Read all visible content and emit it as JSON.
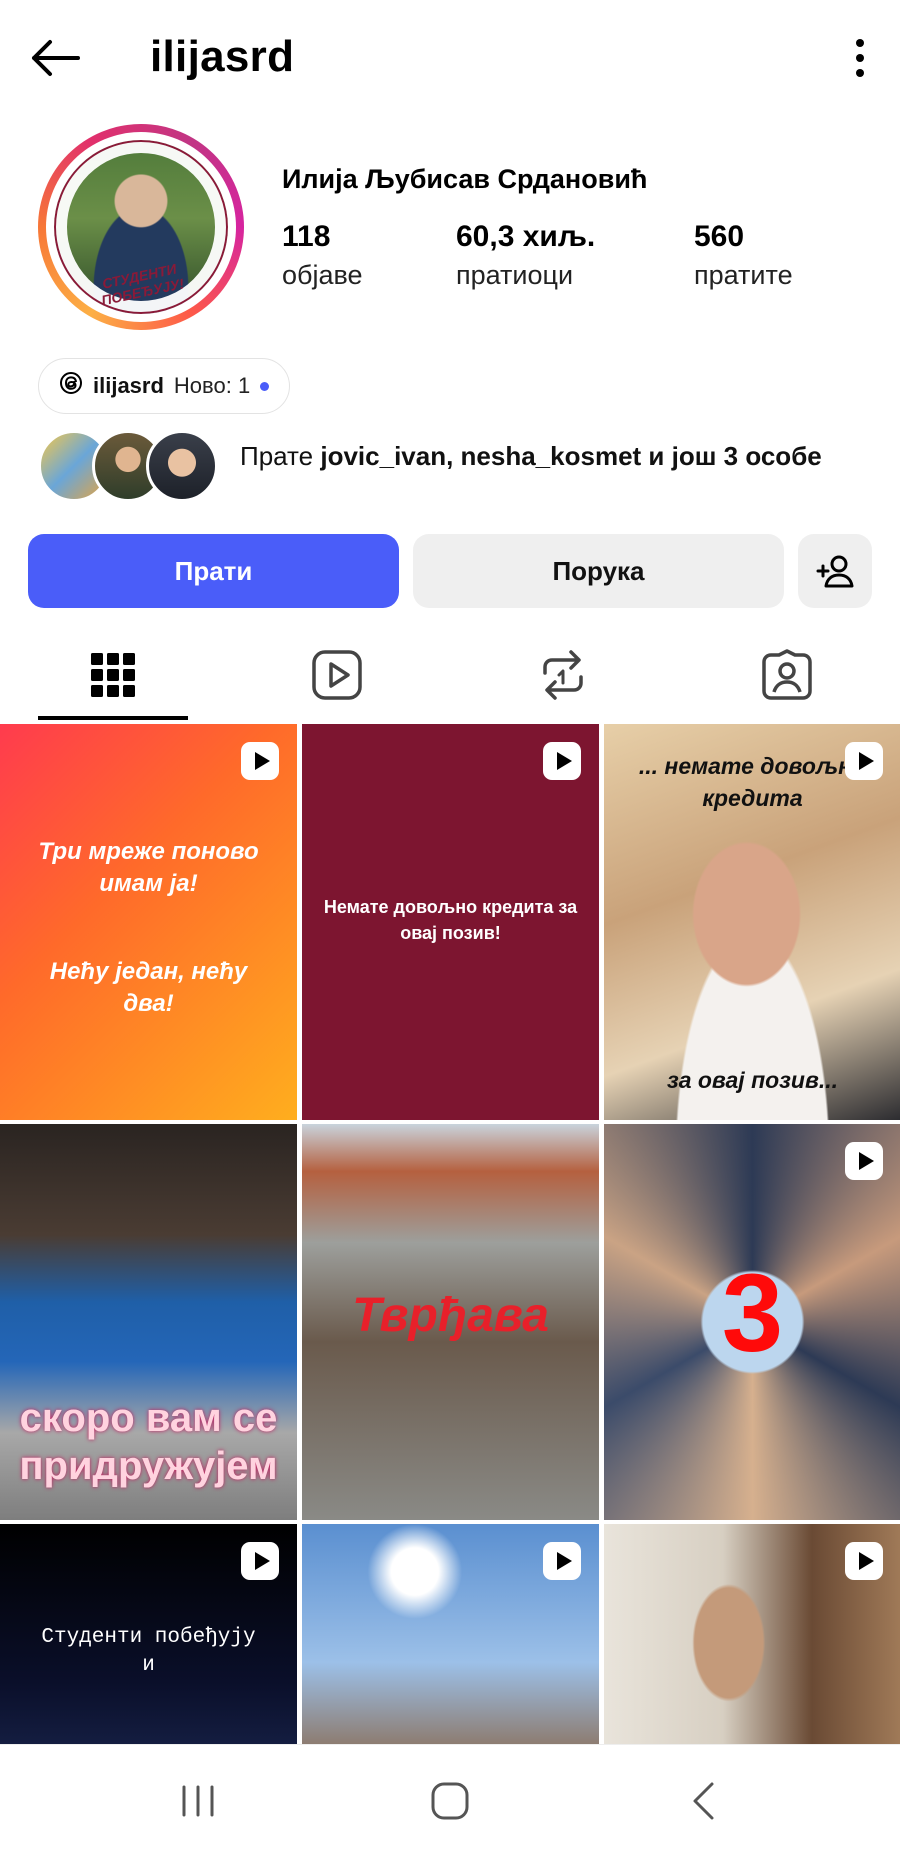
{
  "header": {
    "username": "ilijasrd"
  },
  "profile": {
    "full_name": "Илија Љубисав Срдановић",
    "avatar_caption": "СТУДЕНТИ ПОБЕЂУЈУ!",
    "stats": [
      {
        "value": "118",
        "label": "објаве"
      },
      {
        "value": "60,3 хиљ.",
        "label": "пратиоци"
      },
      {
        "value": "560",
        "label": "пратите"
      }
    ],
    "threads": {
      "handle": "ilijasrd",
      "new_label": "Ново: 1"
    },
    "mutual": {
      "prefix": "Прате",
      "names": "jovic_ivan, nesha_kosmet",
      "suffix": "и још 3 особе"
    }
  },
  "actions": {
    "follow": "Прати",
    "message": "Порука"
  },
  "tabs": [
    {
      "icon": "grid-icon",
      "active": true
    },
    {
      "icon": "reels-icon",
      "active": false
    },
    {
      "icon": "repost-icon",
      "active": false
    },
    {
      "icon": "tagged-icon",
      "active": false
    }
  ],
  "posts": [
    {
      "text": "Три мреже поново имам ја!",
      "text2": "Нећу један, нећу два!",
      "reel": true
    },
    {
      "text": "Немате довољно кредита за овај позив!",
      "reel": true
    },
    {
      "text": "... немате довољно кредита",
      "text2": "за овај позив...",
      "reel": true
    },
    {
      "text": "скоро вам се придружујем",
      "reel": false
    },
    {
      "text": "Тврђава",
      "reel": false
    },
    {
      "text": "3",
      "reel": true
    },
    {
      "text": "Студенти побеђују",
      "text2": "и",
      "reel": true
    },
    {
      "text": "",
      "reel": true
    },
    {
      "text": "",
      "reel": true
    }
  ],
  "colors": {
    "accent": "#4a5df9",
    "secondary_button": "#efefef",
    "maroon_post": "#7d1530"
  }
}
